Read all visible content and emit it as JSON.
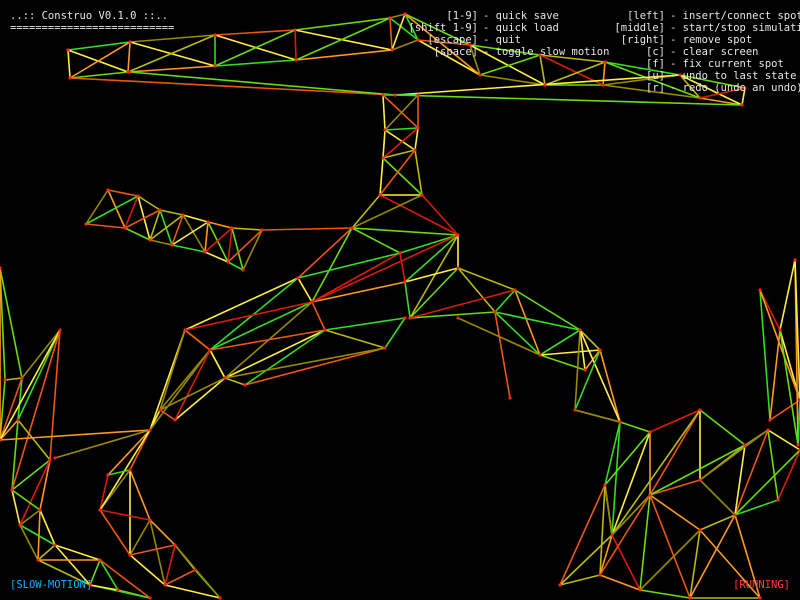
{
  "app": {
    "title": "..:: Construo V0.1.0 ::..",
    "title_rule": "=========================="
  },
  "help_left": [
    {
      "key": "[1-9]",
      "desc": "- quick save"
    },
    {
      "key": "[shift 1-9]",
      "desc": "- quick load"
    },
    {
      "key": "[escape]",
      "desc": "- quit"
    },
    {
      "key": "[space]",
      "desc": "- toggle slow motion"
    }
  ],
  "help_right": [
    {
      "key": "[left]",
      "desc": "- insert/connect spots"
    },
    {
      "key": "[middle]",
      "desc": "- start/stop simulation"
    },
    {
      "key": "[right]",
      "desc": "- remove spot"
    },
    {
      "key": "[c]",
      "desc": "- clear screen"
    },
    {
      "key": "[f]",
      "desc": "- fix current spot"
    },
    {
      "key": "[u]",
      "desc": "- undo to last state"
    },
    {
      "key": "[r]",
      "desc": "- redo (undo an undo)"
    }
  ],
  "status": {
    "mode": "[SLOW-MOTION]",
    "state": "[RUNNING]",
    "mode_color": "#00b4ff",
    "state_color": "#ff3c3c"
  },
  "palette": {
    "background": "#000000",
    "spot": "#ff2020",
    "springs": [
      "#33dd22",
      "#66dd11",
      "#bbbb11",
      "#ffee44",
      "#ff9922",
      "#ee5511",
      "#dd1a0a",
      "#998800"
    ]
  }
}
